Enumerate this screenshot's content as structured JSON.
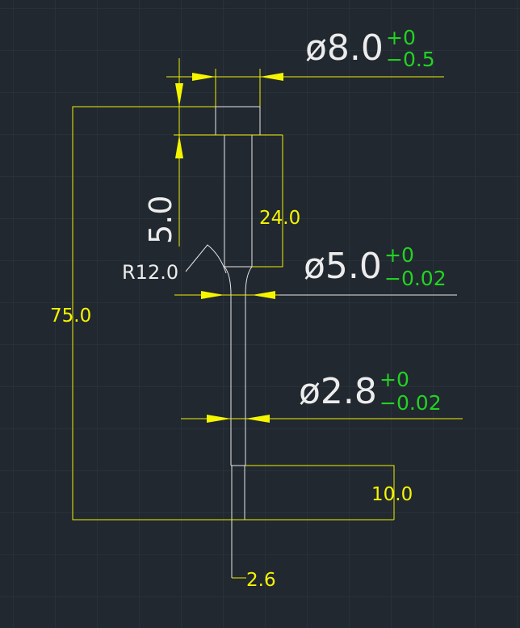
{
  "drawing": {
    "background": "#212830",
    "colors": {
      "part_outline": "#e8e8e8",
      "dimension": "#f0f000",
      "tolerance": "#22d322",
      "label": "#ececec"
    },
    "dimensions": {
      "head_diameter": {
        "text": "ø8.0",
        "tol_upper": "+0",
        "tol_lower": "−0.5"
      },
      "body_diameter": {
        "text": "ø5.0",
        "tol_upper": "+0",
        "tol_lower": "−0.02"
      },
      "tip_diameter": {
        "text": "ø2.8",
        "tol_upper": "+0",
        "tol_lower": "−0.02"
      },
      "head_height": "5.0",
      "body_length": "24.0",
      "fillet_radius": "R12.0",
      "overall_length": "75.0",
      "tip_step_length": "10.0",
      "tip_end_diameter": "2.6"
    }
  }
}
